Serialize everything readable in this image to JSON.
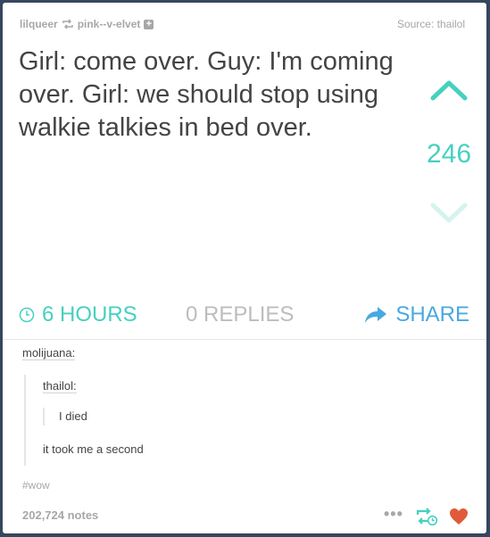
{
  "header": {
    "reblogger": "lilqueer",
    "original_poster": "pink--v-elvet",
    "source_label": "Source: thailol"
  },
  "post": {
    "quote": "Girl: come over. Guy: I'm coming over. Girl: we should stop using walkie  talkies in bed over.",
    "vote_count": "246",
    "time_label": "6 HOURS",
    "replies_label": "0 REPLIES",
    "share_label": "SHARE"
  },
  "comments": {
    "user1": "molijuana:",
    "user2": "thailol:",
    "nested_text": "I died",
    "reply_text": "it took me a second"
  },
  "footer": {
    "tag": "#wow",
    "notes": "202,724 notes",
    "more": "•••"
  },
  "colors": {
    "accent_teal": "#46d0c0",
    "share_blue": "#4aa8e0",
    "like_red": "#e05a3a",
    "background": "#36465d"
  }
}
